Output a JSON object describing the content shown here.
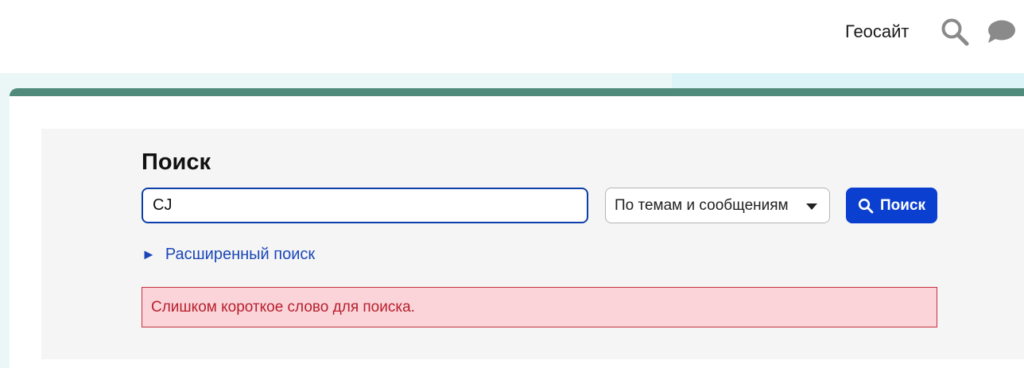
{
  "header": {
    "site_link": "Геосайт",
    "search_icon": "search-icon",
    "chat_icon": "chat-icon"
  },
  "search": {
    "title": "Поиск",
    "query_value": "CJ",
    "scope_selected": "По темам и сообщениям",
    "submit_label": "Поиск",
    "advanced_label": "Расширенный поиск",
    "advanced_icon": "triangle-right-icon",
    "error_message": "Слишком короткое слово для поиска."
  },
  "colors": {
    "accent": "#0a3fcf",
    "card_border": "#4f8a7b",
    "error_bg": "#fad4d9",
    "error_text": "#b8202e",
    "link": "#1a47b8"
  }
}
